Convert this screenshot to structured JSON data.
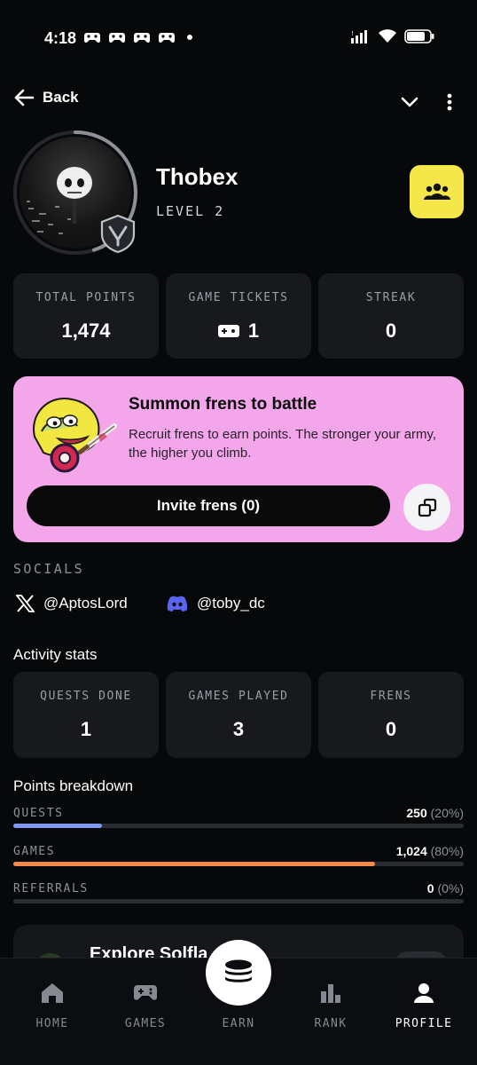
{
  "status_bar": {
    "time": "4:18"
  },
  "header": {
    "back_label": "Back"
  },
  "profile": {
    "username": "Thobex",
    "level": "LEVEL 2",
    "level_progress": 0.45
  },
  "stats": [
    {
      "label": "TOTAL POINTS",
      "value": "1,474"
    },
    {
      "label": "GAME TICKETS",
      "value": "1",
      "icon": "ticket-icon"
    },
    {
      "label": "STREAK",
      "value": "0"
    }
  ],
  "banner": {
    "title": "Summon frens to battle",
    "description": "Recruit frens to earn points. The stronger your army, the higher you climb.",
    "invite_label": "Invite frens (0)",
    "background_color": "#f3a6ea"
  },
  "socials": {
    "label": "SOCIALS",
    "items": [
      {
        "icon": "x-logo-icon",
        "handle": "@AptosLord"
      },
      {
        "icon": "discord-icon",
        "handle": "@toby_dc"
      }
    ]
  },
  "activity": {
    "title": "Activity stats",
    "items": [
      {
        "label": "QUESTS DONE",
        "value": "1"
      },
      {
        "label": "GAMES PLAYED",
        "value": "3"
      },
      {
        "label": "FRENS",
        "value": "0"
      }
    ]
  },
  "points_breakdown": {
    "title": "Points breakdown",
    "rows": [
      {
        "label": "QUESTS",
        "value": "250",
        "percent": "(20%)",
        "fraction": 0.196,
        "color": "#7f99f0"
      },
      {
        "label": "GAMES",
        "value": "1,024",
        "percent": "(80%)",
        "fraction": 0.803,
        "color": "#f4894a"
      },
      {
        "label": "REFERRALS",
        "value": "0",
        "percent": "(0%)",
        "fraction": 0,
        "color": "#8d9199"
      }
    ]
  },
  "explore": {
    "title": "Explore Solfla"
  },
  "bottom_nav": {
    "items": [
      {
        "label": "HOME",
        "icon": "home-icon"
      },
      {
        "label": "GAMES",
        "icon": "gamepad-icon"
      },
      {
        "label": "EARN",
        "icon": "coins-stack-icon"
      },
      {
        "label": "RANK",
        "icon": "bar-chart-icon"
      },
      {
        "label": "PROFILE",
        "icon": "person-icon",
        "active": true
      }
    ]
  },
  "colors": {
    "accent_yellow": "#f5e74a",
    "background": "#07080a",
    "card": "#17191d"
  }
}
